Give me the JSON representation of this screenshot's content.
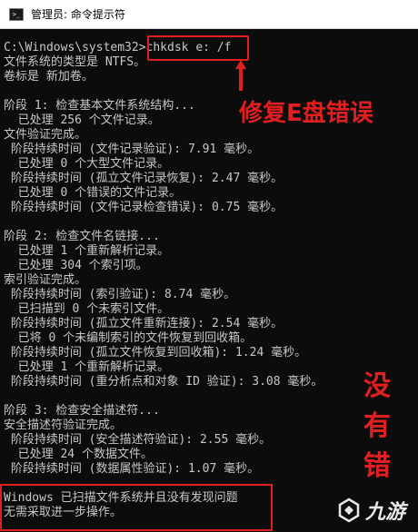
{
  "window": {
    "title": "管理员: 命令提示符",
    "icon": "cmd-icon"
  },
  "console": {
    "lines": [
      "C:\\Windows\\system32>chkdsk e: /f",
      "文件系统的类型是 NTFS。",
      "卷标是 新加卷。",
      "",
      "阶段 1: 检查基本文件系统结构...",
      "  已处理 256 个文件记录。",
      "文件验证完成。",
      " 阶段持续时间 (文件记录验证): 7.91 毫秒。",
      "  已处理 0 个大型文件记录。",
      " 阶段持续时间 (孤立文件记录恢复): 2.47 毫秒。",
      "  已处理 0 个错误的文件记录。",
      " 阶段持续时间 (文件记录检查错误): 0.75 毫秒。",
      "",
      "阶段 2: 检查文件名链接...",
      "  已处理 1 个重新解析记录。",
      "  已处理 304 个索引项。",
      "索引验证完成。",
      " 阶段持续时间 (索引验证): 8.74 毫秒。",
      "  已扫描到 0 个未索引文件。",
      " 阶段持续时间 (孤立文件重新连接): 2.54 毫秒。",
      "  已将 0 个未编制索引的文件恢复到回收箱。",
      " 阶段持续时间 (孤立文件恢复到回收箱): 1.24 毫秒。",
      "  已处理 1 个重新解析记录。",
      " 阶段持续时间 (重分析点和对象 ID 验证): 3.08 毫秒。",
      "",
      "阶段 3: 检查安全描述符...",
      "安全描述符验证完成。",
      " 阶段持续时间 (安全描述符验证): 2.55 毫秒。",
      "  已处理 24 个数据文件。",
      " 阶段持续时间 (数据属性验证): 1.07 毫秒。",
      "",
      "Windows 已扫描文件系统并且没有发现问题",
      "无需采取进一步操作。"
    ]
  },
  "annotations": {
    "repair": "修复E盘错误",
    "vertical": "没有错",
    "color": "#e02020"
  },
  "watermark": {
    "text": "九游",
    "icon": "jiuyou-logo-icon"
  }
}
